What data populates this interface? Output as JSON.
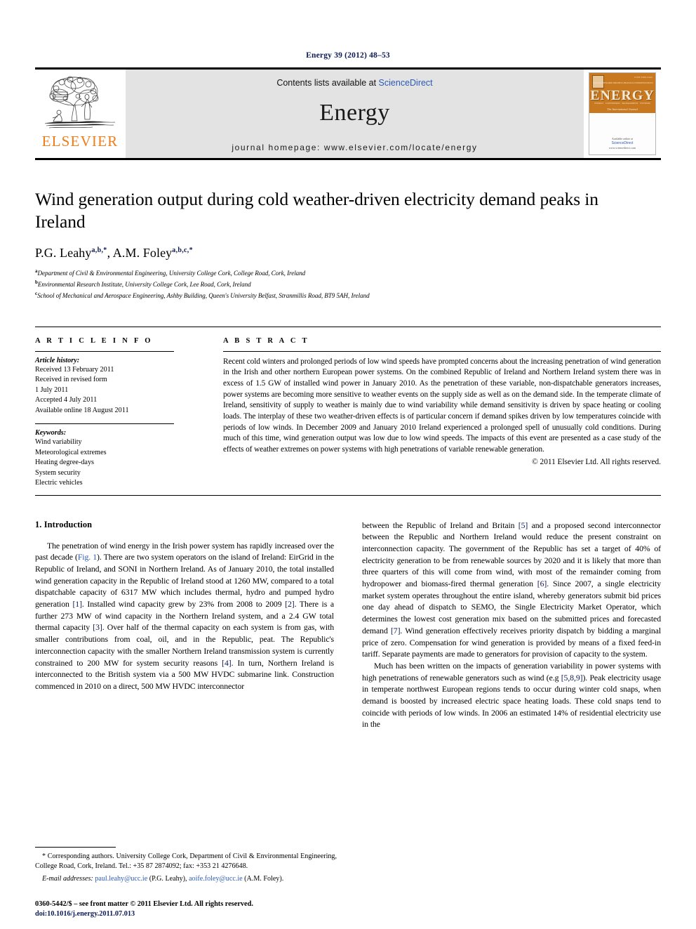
{
  "running_head": "Energy 39 (2012) 48–53",
  "masthead": {
    "publisher_name": "ELSEVIER",
    "contents_prefix": "Contents lists available at ",
    "sciencedirect": "ScienceDirect",
    "journal_name": "Energy",
    "homepage": "journal homepage: www.elsevier.com/locate/energy",
    "cover": {
      "title": "ENERGY",
      "issn": "ISSN 0360-5442",
      "tagline": "The International Journal",
      "top_words": [
        "THERMODYNAMICS",
        "MODELLING",
        "POLLUTION",
        "RESOURCES"
      ],
      "bottom_words": [
        "ENERGY",
        "CONVERSION",
        "MANAGEMENT",
        "SYSTEMS"
      ],
      "available_online": "Available online at",
      "platform": "ScienceDirect",
      "platform_url": "www.sciencedirect.com"
    }
  },
  "article": {
    "title": "Wind generation output during cold weather-driven electricity demand peaks in Ireland",
    "authors": [
      {
        "name": "P.G. Leahy",
        "marks": "a,b,*"
      },
      {
        "name": "A.M. Foley",
        "marks": "a,b,c,*"
      }
    ],
    "affiliations": [
      {
        "mark": "a",
        "text": "Department of Civil & Environmental Engineering, University College Cork, College Road, Cork, Ireland"
      },
      {
        "mark": "b",
        "text": "Environmental Research Institute, University College Cork, Lee Road, Cork, Ireland"
      },
      {
        "mark": "c",
        "text": "School of Mechanical and Aerospace Engineering, Ashby Building, Queen's University Belfast, Stranmillis Road, BT9 5AH, Ireland"
      }
    ]
  },
  "info": {
    "heading": "A R T I C L E   I N F O",
    "history_label": "Article history:",
    "history": [
      "Received 13 February 2011",
      "Received in revised form",
      "1 July 2011",
      "Accepted 4 July 2011",
      "Available online 18 August 2011"
    ],
    "keywords_label": "Keywords:",
    "keywords": [
      "Wind variability",
      "Meteorological extremes",
      "Heating degree-days",
      "System security",
      "Electric vehicles"
    ]
  },
  "abstract": {
    "heading": "A B S T R A C T",
    "text": "Recent cold winters and prolonged periods of low wind speeds have prompted concerns about the increasing penetration of wind generation in the Irish and other northern European power systems. On the combined Republic of Ireland and Northern Ireland system there was in excess of 1.5 GW of installed wind power in January 2010. As the penetration of these variable, non-dispatchable generators increases, power systems are becoming more sensitive to weather events on the supply side as well as on the demand side. In the temperate climate of Ireland, sensitivity of supply to weather is mainly due to wind variability while demand sensitivity is driven by space heating or cooling loads. The interplay of these two weather-driven effects is of particular concern if demand spikes driven by low temperatures coincide with periods of low winds. In December 2009 and January 2010 Ireland experienced a prolonged spell of unusually cold conditions. During much of this time, wind generation output was low due to low wind speeds. The impacts of this event are presented as a case study of the effects of weather extremes on power systems with high penetrations of variable renewable generation.",
    "copyright": "© 2011 Elsevier Ltd. All rights reserved."
  },
  "body": {
    "section_heading": "1. Introduction",
    "left_paragraph_1_a": "The penetration of wind energy in the Irish power system has rapidly increased over the past decade (",
    "left_fig_ref": "Fig. 1",
    "left_paragraph_1_b": "). There are two system operators on the island of Ireland: EirGrid in the Republic of Ireland, and SONI in Northern Ireland. As of January 2010, the total installed wind generation capacity in the Republic of Ireland stood at 1260 MW, compared to a total dispatchable capacity of 6317 MW which includes thermal, hydro and pumped hydro generation ",
    "ref1": "[1]",
    "left_paragraph_1_c": ". Installed wind capacity grew by 23% from 2008 to 2009 ",
    "ref2": "[2]",
    "left_paragraph_1_d": ". There is a further 273 MW of wind capacity in the Northern Ireland system, and a 2.4 GW total thermal capacity ",
    "ref3": "[3]",
    "left_paragraph_1_e": ". Over half of the thermal capacity on each system is from gas, with smaller contributions from coal, oil, and in the Republic, peat. The Republic's interconnection capacity with the smaller Northern Ireland transmission system is currently constrained to 200 MW for system security reasons ",
    "ref4": "[4]",
    "left_paragraph_1_f": ". In turn, Northern Ireland is interconnected to the British system via a 500 MW HVDC submarine link. Construction commenced in 2010 on a direct, 500 MW HVDC interconnector",
    "right_paragraph_1_a": "between the Republic of Ireland and Britain ",
    "ref5": "[5]",
    "right_paragraph_1_b": " and a proposed second interconnector between the Republic and Northern Ireland would reduce the present constraint on interconnection capacity. The government of the Republic has set a target of 40% of electricity generation to be from renewable sources by 2020 and it is likely that more than three quarters of this will come from wind, with most of the remainder coming from hydropower and biomass-fired thermal generation ",
    "ref6": "[6]",
    "right_paragraph_1_c": ". Since 2007, a single electricity market system operates throughout the entire island, whereby generators submit bid prices one day ahead of dispatch to SEMO, the Single Electricity Market Operator, which determines the lowest cost generation mix based on the submitted prices and forecasted demand ",
    "ref7": "[7]",
    "right_paragraph_1_d": ". Wind generation effectively receives priority dispatch by bidding a marginal price of zero. Compensation for wind generation is provided by means of a fixed feed-in tariff. Separate payments are made to generators for provision of capacity to the system.",
    "right_paragraph_2_a": "Much has been written on the impacts of generation variability in power systems with high penetrations of renewable generators such as wind (e.g ",
    "ref589": "[5,8,9]",
    "right_paragraph_2_b": "). Peak electricity usage in temperate northwest European regions tends to occur during winter cold snaps, when demand is boosted by increased electric space heating loads. These cold snaps tend to coincide with periods of low winds. In 2006 an estimated 14% of residential electricity use in the"
  },
  "footnotes": {
    "corresponding": "* Corresponding authors. University College Cork, Department of Civil & Environmental Engineering, College Road, Cork, Ireland. Tel.: +35 87 2874092; fax: +353 21 4276648.",
    "email_label": "E-mail addresses:",
    "email1": "paul.leahy@ucc.ie",
    "email1_owner": "(P.G. Leahy)",
    "email2": "aoife.foley@ucc.ie",
    "email2_owner": "(A.M. Foley)."
  },
  "imprint": {
    "line1": "0360-5442/$ – see front matter © 2011 Elsevier Ltd. All rights reserved.",
    "doi": "doi:10.1016/j.energy.2011.07.013"
  },
  "colors": {
    "elsevier_orange": "#ef7d19",
    "link_blue": "#2b59b5",
    "ref_navy": "#0d1a54",
    "banner_grey": "#e3e3e3",
    "cover_orange": "#c8781f"
  }
}
